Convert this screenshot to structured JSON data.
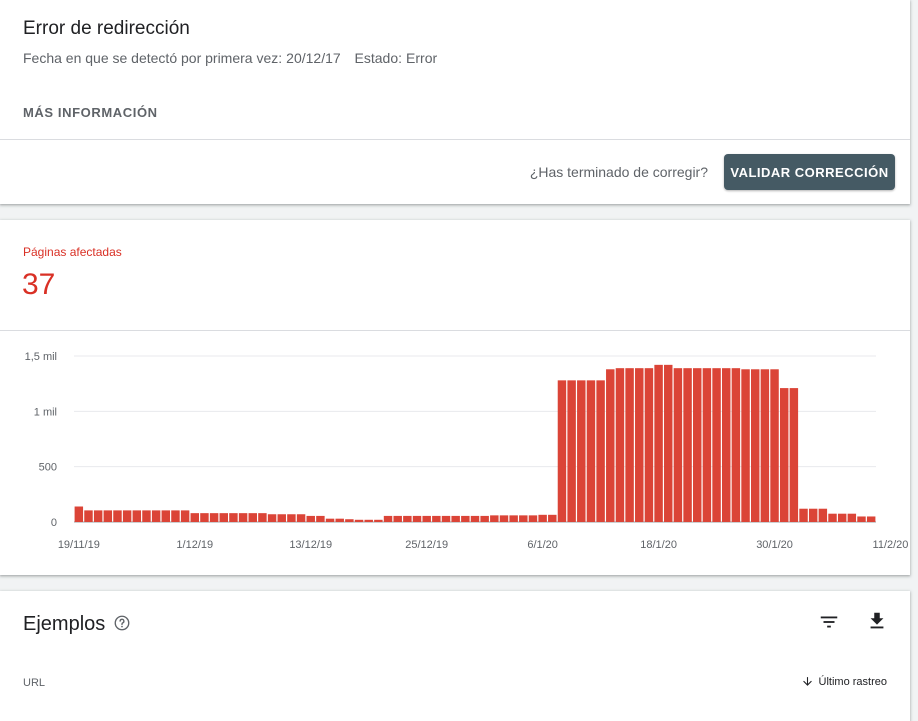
{
  "issue": {
    "title": "Error de redirección",
    "first_detected_label": "Fecha en que se detectó por primera vez:",
    "first_detected_value": "20/12/17",
    "status_label": "Estado:",
    "status_value": "Error",
    "more_info": "MÁS INFORMACIÓN",
    "finished_question": "¿Has terminado de corregir?",
    "validate_button": "VALIDAR CORRECCIÓN",
    "validate_color": "#455a64"
  },
  "affected": {
    "label": "Páginas afectadas",
    "count": "37",
    "color": "#d93025"
  },
  "chart_data": {
    "type": "bar",
    "ylabel": "",
    "xlabel": "",
    "ylim": [
      0,
      1500
    ],
    "y_ticks": [
      0,
      500,
      1000,
      1500
    ],
    "y_tick_labels": [
      "0",
      "500",
      "1 mil",
      "1,5 mil"
    ],
    "x_tick_labels": [
      "19/11/19",
      "1/12/19",
      "13/12/19",
      "25/12/19",
      "6/1/20",
      "18/1/20",
      "30/1/20",
      "11/2/20"
    ],
    "x_tick_indices": [
      0,
      12,
      24,
      36,
      48,
      60,
      72,
      84
    ],
    "bar_color": "#db4437",
    "grid": true,
    "values": [
      140,
      105,
      105,
      105,
      105,
      105,
      105,
      105,
      105,
      105,
      105,
      105,
      80,
      80,
      80,
      80,
      80,
      80,
      80,
      80,
      70,
      70,
      70,
      70,
      55,
      55,
      30,
      30,
      25,
      20,
      20,
      20,
      55,
      55,
      55,
      55,
      55,
      55,
      55,
      55,
      55,
      55,
      55,
      60,
      60,
      60,
      60,
      60,
      65,
      65,
      1280,
      1280,
      1280,
      1280,
      1280,
      1380,
      1390,
      1390,
      1390,
      1390,
      1420,
      1420,
      1390,
      1390,
      1390,
      1390,
      1390,
      1390,
      1390,
      1380,
      1380,
      1380,
      1380,
      1210,
      1210,
      120,
      120,
      120,
      75,
      75,
      75,
      50,
      50
    ]
  },
  "examples": {
    "title": "Ejemplos",
    "col_url": "URL",
    "col_last_crawl": "Último rastreo"
  }
}
